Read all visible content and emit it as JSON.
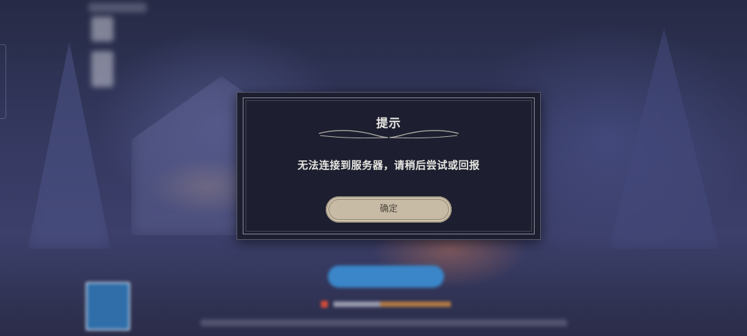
{
  "dialog": {
    "title": "提示",
    "message": "无法连接到服务器，请稍后尝试或回报",
    "confirm_label": "确定"
  },
  "colors": {
    "dialog_background": "#1d1f30",
    "dialog_border": "#8d8f9b",
    "button_fill": "#c7bba6",
    "button_text": "#4e463a",
    "text": "#ecebe6"
  },
  "icons": {
    "title_ornament": "ornament-divider-icon"
  }
}
